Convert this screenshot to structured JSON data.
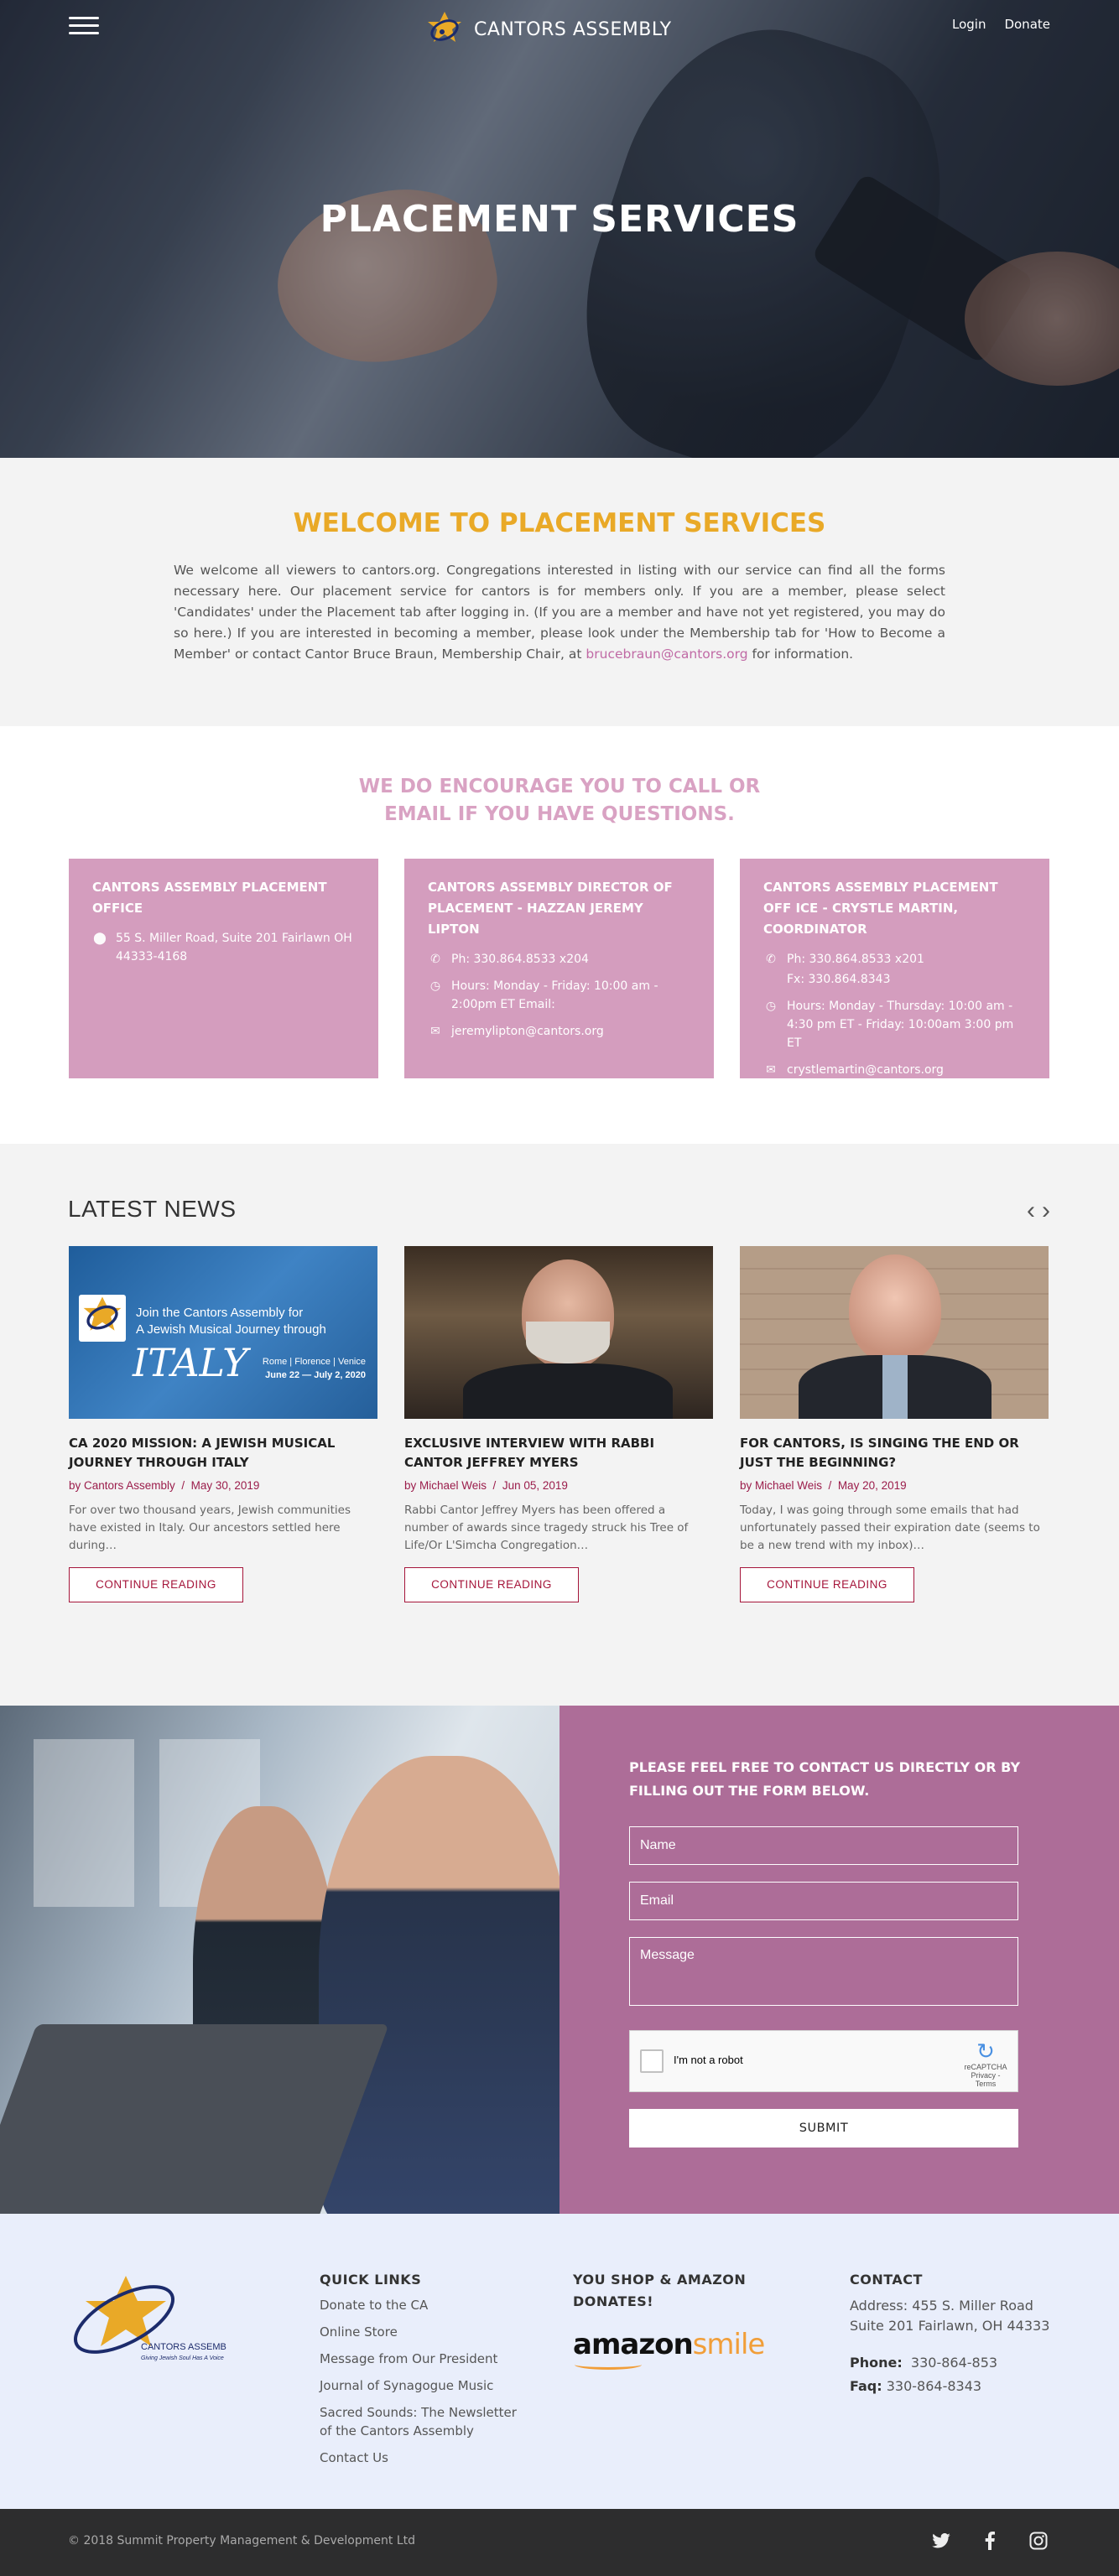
{
  "header": {
    "brand": "CANTORS ASSEMBLY",
    "login": "Login",
    "donate": "Donate",
    "hero_title": "PLACEMENT SERVICES"
  },
  "welcome": {
    "title": "WELCOME TO PLACEMENT SERVICES",
    "text_before": "We welcome all viewers to cantors.org.  Congregations interested in listing with our service can find all the forms necessary here.   Our placement service for cantors is for members only.    If you are a member, please select 'Candidates' under the Placement tab after logging in. (If you are a member and have not yet registered, you may do so here.)    If you are interested in becoming a member, please look under the Membership tab for 'How to Become a Member' or contact Cantor Bruce Braun, Membership Chair, at ",
    "email": "brucebraun@cantors.org",
    "text_after": " for information."
  },
  "encourage": {
    "line1": "WE DO ENCOURAGE YOU TO CALL OR",
    "line2": "EMAIL IF YOU HAVE QUESTIONS.",
    "cards": [
      {
        "title": "CANTORS ASSEMBLY PLACEMENT OFFICE",
        "address": "55 S. Miller Road, Suite 201 Fairlawn OH 44333-4168"
      },
      {
        "title": "CANTORS ASSEMBLY DIRECTOR OF PLACEMENT - HAZZAN JEREMY LIPTON",
        "phone": "Ph: 330.864.8533 x204",
        "hours": "Hours:  Monday - Friday: 10:00 am - 2:00pm ET Email:",
        "email": "jeremylipton@cantors.org"
      },
      {
        "title": "CANTORS ASSEMBLY PLACEMENT OFF ICE - CRYSTLE MARTIN, COORDINATOR",
        "phone": "Ph: 330.864.8533 x201",
        "fax": "Fx: 330.864.8343",
        "hours": "Hours:  Monday - Thursday: 10:00 am - 4:30 pm ET  -  Friday: 10:00am 3:00 pm ET",
        "email": "crystlemartin@cantors.org"
      }
    ]
  },
  "news": {
    "title": "LATEST NEWS",
    "posts": [
      {
        "title": "CA 2020 MISSION: A JEWISH MUSICAL JOURNEY THROUGH ITALY",
        "author": "by Cantors Assembly",
        "date": "May 30, 2019",
        "excerpt": "For over two thousand years, Jewish communities have existed in Italy. Our ancestors settled here during…",
        "button": "CONTINUE READING",
        "thumb_line1": "Join the Cantors Assembly for",
        "thumb_line2": "A Jewish Musical Journey through",
        "thumb_big": "ITALY",
        "thumb_cities": "Rome | Florence | Venice",
        "thumb_dates": "June 22 — July 2, 2020"
      },
      {
        "title": "EXCLUSIVE INTERVIEW WITH RABBI CANTOR JEFFREY MYERS",
        "author": "by Michael Weis",
        "date": "Jun 05, 2019",
        "excerpt": "Rabbi Cantor Jeffrey Myers has been offered a number of awards since tragedy struck his Tree of Life/Or L'Simcha Congregation…",
        "button": "CONTINUE READING"
      },
      {
        "title": "FOR CANTORS, IS SINGING THE END OR JUST THE BEGINNING?",
        "author": "by Michael Weis",
        "date": "May 20, 2019",
        "excerpt": "Today, I was going through some emails that had unfortunately passed their expiration date (seems to be a new trend with my inbox)…",
        "button": "CONTINUE READING"
      }
    ]
  },
  "contact_form": {
    "heading": "PLEASE FEEL FREE TO CONTACT US DIRECTLY OR BY FILLING OUT THE FORM BELOW.",
    "name_placeholder": "Name",
    "email_placeholder": "Email",
    "message_placeholder": "Message",
    "recaptcha_label": "I'm not a robot",
    "recaptcha_brand": "reCAPTCHA",
    "recaptcha_terms": "Privacy - Terms",
    "submit": "SUBMIT"
  },
  "footer": {
    "logo_text": "CANTORS ASSEMBLY",
    "logo_tagline": "Giving Jewish Soul Has A Voice",
    "quick_links_title": "QUICK LINKS",
    "quick_links": [
      "Donate to the CA",
      "Online Store",
      "Message from Our President",
      "Journal of Synagogue Music",
      "Sacred Sounds: The Newsletter of the Cantors Assembly",
      "Contact Us"
    ],
    "amazon_title": "YOU SHOP & AMAZON DONATES!",
    "amazon_word": "amazon",
    "amazon_smile": "smile",
    "contact_title": "CONTACT",
    "address": "Address: 455 S. Miller Road Suite 201 Fairlawn, OH 44333",
    "phone_label": "Phone:",
    "phone": "330-864-853",
    "fax_label": "Faq:",
    "fax": "330-864-8343"
  },
  "bottom_bar": {
    "copyright": "© 2018 Summit Property Management & Development Ltd",
    "icons": [
      "twitter-icon",
      "facebook-icon",
      "instagram-icon"
    ]
  },
  "colors": {
    "gold": "#e9a927",
    "pink_card": "#d49dbe",
    "form_bg": "#ad6d98",
    "news_accent": "#a5153a",
    "footer_bg": "#e9eefb",
    "bottom_bg": "#2d2d2e"
  }
}
